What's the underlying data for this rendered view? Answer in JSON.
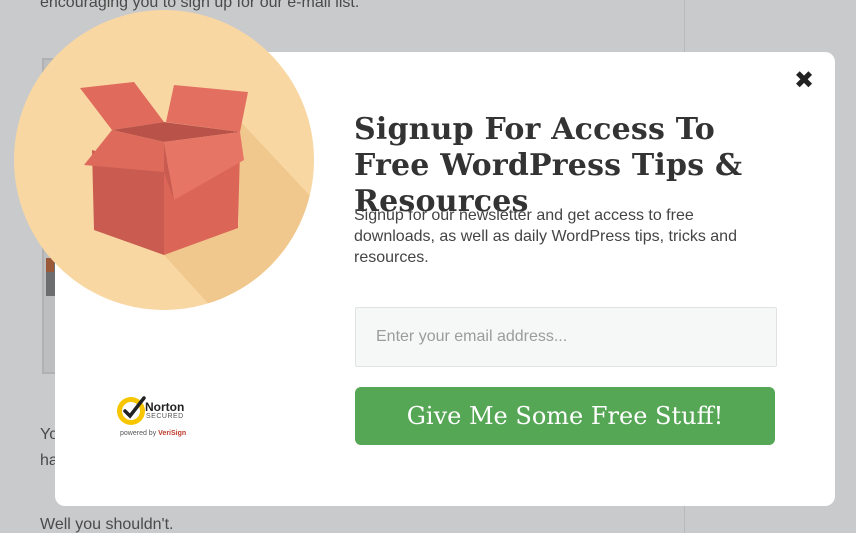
{
  "background": {
    "top_text": "encouraging you to sign up for our e-mail list.",
    "frag_1": "Yo",
    "frag_2": "ha",
    "bottom_text": "Well you shouldn't."
  },
  "modal": {
    "close_glyph": "✖",
    "headline": "Signup For Access To Free WordPress Tips & Resources",
    "subtext": "Signup for our newsletter and get access to free downloads, as well as daily WordPress tips, tricks and resources.",
    "email_placeholder": "Enter your email address...",
    "cta_label": "Give Me Some Free Stuff!",
    "badge": {
      "brand": "Norton",
      "secured": "SECURED",
      "powered_prefix": "powered by ",
      "powered_brand": "VeriSign"
    }
  },
  "colors": {
    "cta": "#55a655",
    "circle": "#f8d7a3",
    "box": "#e46a5a"
  },
  "icons": [
    "close-icon",
    "box-illustration",
    "norton-check-icon"
  ]
}
